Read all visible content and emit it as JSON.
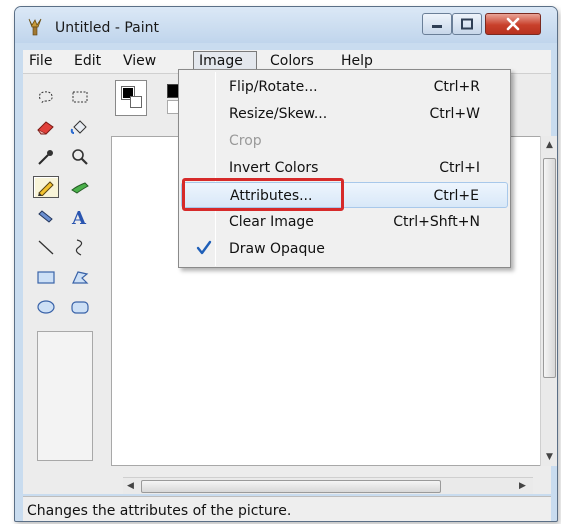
{
  "window": {
    "title": "Untitled - Paint",
    "controls": {
      "minimize": "minimize",
      "maximize": "maximize",
      "close": "close"
    }
  },
  "menubar": {
    "items": [
      "File",
      "Edit",
      "View",
      "Image",
      "Colors",
      "Help"
    ],
    "open_menu": "Image"
  },
  "image_menu": {
    "items": [
      {
        "label": "Flip/Rotate...",
        "shortcut": "Ctrl+R",
        "enabled": true,
        "checked": false
      },
      {
        "label": "Resize/Skew...",
        "shortcut": "Ctrl+W",
        "enabled": true,
        "checked": false
      },
      {
        "label": "Crop",
        "shortcut": "",
        "enabled": false,
        "checked": false
      },
      {
        "label": "Invert Colors",
        "shortcut": "Ctrl+I",
        "enabled": true,
        "checked": false
      },
      {
        "label": "Attributes...",
        "shortcut": "Ctrl+E",
        "enabled": true,
        "checked": false,
        "hovered": true,
        "highlighted": true
      },
      {
        "label": "Clear Image",
        "shortcut": "Ctrl+Shft+N",
        "enabled": true,
        "checked": false
      },
      {
        "label": "Draw Opaque",
        "shortcut": "",
        "enabled": true,
        "checked": true
      }
    ]
  },
  "toolbox": {
    "tools": [
      "free-form-select-icon",
      "select-icon",
      "eraser-icon",
      "fill-icon",
      "pick-color-icon",
      "magnifier-icon",
      "pencil-icon",
      "brush-icon",
      "airbrush-icon",
      "text-icon",
      "line-icon",
      "curve-icon",
      "rectangle-icon",
      "polygon-icon",
      "ellipse-icon",
      "rounded-rectangle-icon"
    ],
    "active_tool": "pencil-icon"
  },
  "colors": {
    "highlight_box": "#d62a2a",
    "menu_hover": "#d8e8f8",
    "check": "#1f5fb8",
    "close_button": "#c8402b"
  },
  "statusbar": {
    "text": "Changes the attributes of the picture."
  }
}
